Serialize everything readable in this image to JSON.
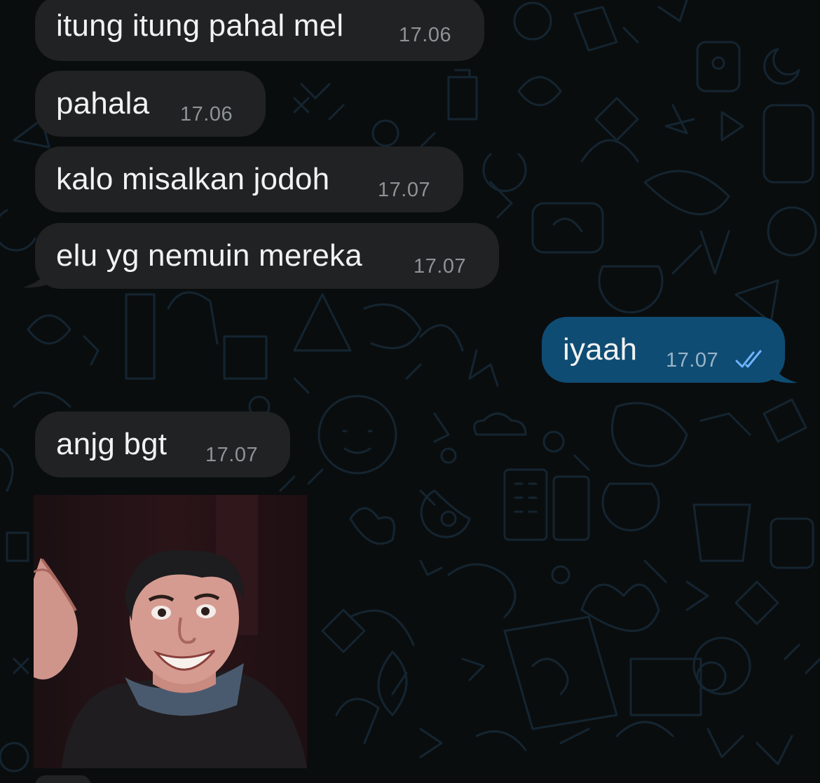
{
  "messages": [
    {
      "text": "itung itung pahal mel",
      "time": "17.06",
      "direction": "in"
    },
    {
      "text": "pahala",
      "time": "17.06",
      "direction": "in"
    },
    {
      "text": "kalo misalkan jodoh",
      "time": "17.07",
      "direction": "in"
    },
    {
      "text": "elu yg nemuin mereka",
      "time": "17.07",
      "direction": "in"
    },
    {
      "text": "iyaah",
      "time": "17.07",
      "direction": "out",
      "status": "read"
    },
    {
      "text": "anjg bgt",
      "time": "17.07",
      "direction": "in"
    }
  ],
  "sticker": {
    "icon": "person-pointing-sticker",
    "direction": "in"
  },
  "icons": {
    "read_receipt": "double-check-icon"
  },
  "colors": {
    "background": "#0a0d0e",
    "incoming_bubble": "#202223",
    "outgoing_bubble": "#0f4c73",
    "timestamp": "#8e9395",
    "read_receipt": "#6fb3ff",
    "wallpaper_line": "#1d3a4f"
  }
}
